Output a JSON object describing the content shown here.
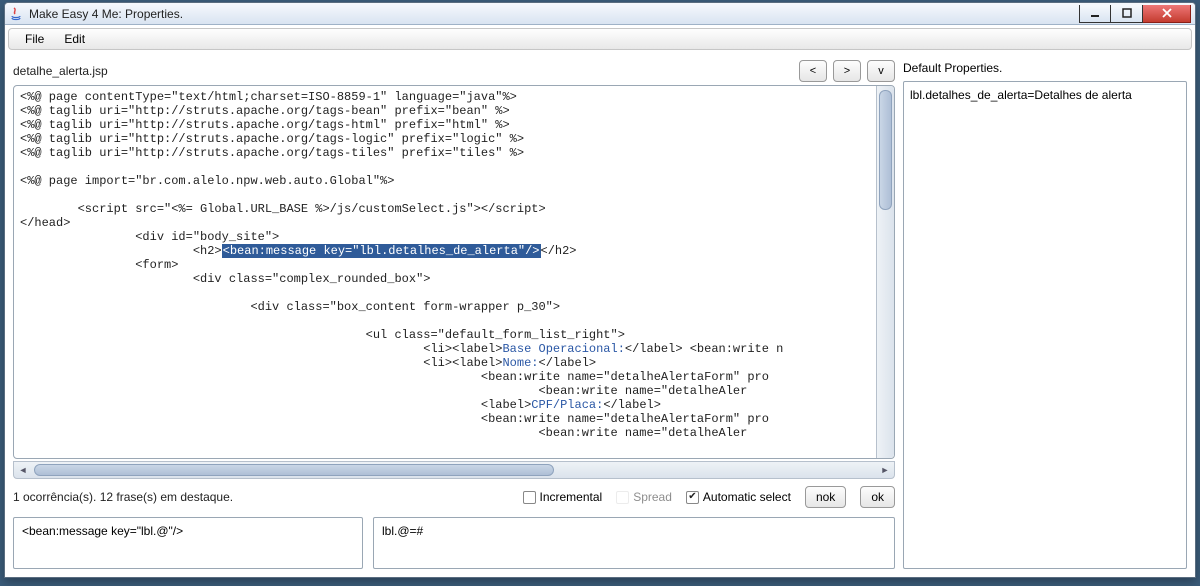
{
  "window": {
    "title": "Make Easy 4 Me: Properties."
  },
  "menu": {
    "file": "File",
    "edit": "Edit"
  },
  "nav": {
    "back": "<",
    "fwd": ">",
    "down": "v"
  },
  "filename": "detalhe_alerta.jsp",
  "code": {
    "l1a": "<%@ page contentType=\"text/html;charset=ISO-8859-1\" language=\"java\"%>",
    "l2a": "<%@ taglib uri=\"http://struts.apache.org/tags-bean\" prefix=\"bean\" %>",
    "l3a": "<%@ taglib uri=\"http://struts.apache.org/tags-html\" prefix=\"html\" %>",
    "l4a": "<%@ taglib uri=\"http://struts.apache.org/tags-logic\" prefix=\"logic\" %>",
    "l5a": "<%@ taglib uri=\"http://struts.apache.org/tags-tiles\" prefix=\"tiles\" %>",
    "l7a": "<%@ page import=\"br.com.alelo.npw.web.auto.Global\"%>",
    "l9a": "        <script src=\"<%= Global.URL_BASE %>/js/customSelect.js\"></scr",
    "l9b": "ipt>",
    "l10": "</head>",
    "l11": "                <div id=\"body_site\">",
    "l12a": "                        <h2>",
    "hl": "<bean:message key=\"lbl.detalhes_de_alerta\"/>",
    "l12b": "</h2>",
    "l13": "                <form>",
    "l14": "                        <div class=\"complex_rounded_box\">",
    "l16": "                                <div class=\"box_content form-wrapper p_30\">",
    "l18": "                                                <ul class=\"default_form_list_right\">",
    "l19a": "                                                        <li><label>",
    "l19b": "Base Operacional:",
    "l19c": "</label> <bean:write n",
    "l20a": "                                                        <li><label>",
    "l20b": "Nome:",
    "l20c": "</label>",
    "l21": "                                                                <bean:write name=\"detalheAlertaForm\" pro",
    "l22": "                                                                        <bean:write name=\"detalheAler",
    "l23a": "                                                                <label>",
    "l23b": "CPF/Placa:",
    "l23c": "</label>",
    "l24": "                                                                <bean:write name=\"detalheAlertaForm\" pro",
    "l25": "                                                                        <bean:write name=\"detalheAler"
  },
  "status": "1 ocorrência(s). 12 frase(s) em destaque.",
  "checks": {
    "incremental": "Incremental",
    "spread": "Spread",
    "auto": "Automatic select"
  },
  "btns": {
    "nok": "nok",
    "ok": "ok"
  },
  "input_left": "<bean:message key=\"lbl.@\"/>",
  "input_right": "lbl.@=#",
  "right": {
    "title": "Default Properties.",
    "entry": "lbl.detalhes_de_alerta=Detalhes de alerta"
  }
}
